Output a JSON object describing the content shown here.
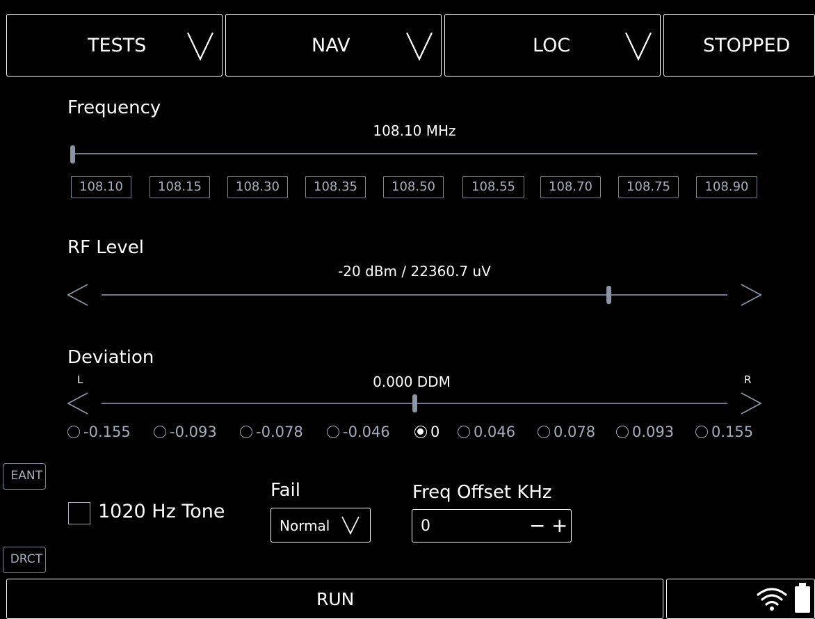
{
  "topbar": {
    "tests": {
      "label": "TESTS",
      "icon": "chevron-down-icon"
    },
    "nav": {
      "label": "NAV",
      "icon": "chevron-down-icon"
    },
    "loc": {
      "label": "LOC",
      "icon": "chevron-down-icon"
    },
    "status": {
      "label": "STOPPED"
    }
  },
  "frequency": {
    "title": "Frequency",
    "value": "108.10 MHz",
    "slider_fraction": 0.0,
    "presets": [
      "108.10",
      "108.15",
      "108.30",
      "108.35",
      "108.50",
      "108.55",
      "108.70",
      "108.75",
      "108.90"
    ]
  },
  "rf_level": {
    "title": "RF Level",
    "value": "-20 dBm / 22360.7 uV",
    "slider_fraction": 0.81,
    "left_icon": "chevron-left-icon",
    "right_icon": "chevron-right-icon"
  },
  "deviation": {
    "title": "Deviation",
    "left_label": "L",
    "right_label": "R",
    "value": "0.000 DDM",
    "slider_fraction": 0.5,
    "options": [
      "-0.155",
      "-0.093",
      "-0.078",
      "-0.046",
      "0",
      "0.046",
      "0.078",
      "0.093",
      "0.155"
    ],
    "selected": "0"
  },
  "side": {
    "eant": "EANT",
    "drct": "DRCT"
  },
  "tone": {
    "label": "1020 Hz Tone",
    "checked": false
  },
  "fail": {
    "label": "Fail",
    "value": "Normal"
  },
  "freq_offset": {
    "label": "Freq Offset KHz",
    "value": "0",
    "minus": "−",
    "plus": "+"
  },
  "bottombar": {
    "run_label": "RUN",
    "wifi_icon": "wifi-icon",
    "battery_icon": "battery-icon"
  },
  "colors": {
    "background": "#000000",
    "foreground": "#ffffff",
    "muted": "#a6afbd",
    "track": "#6d7a8c"
  }
}
